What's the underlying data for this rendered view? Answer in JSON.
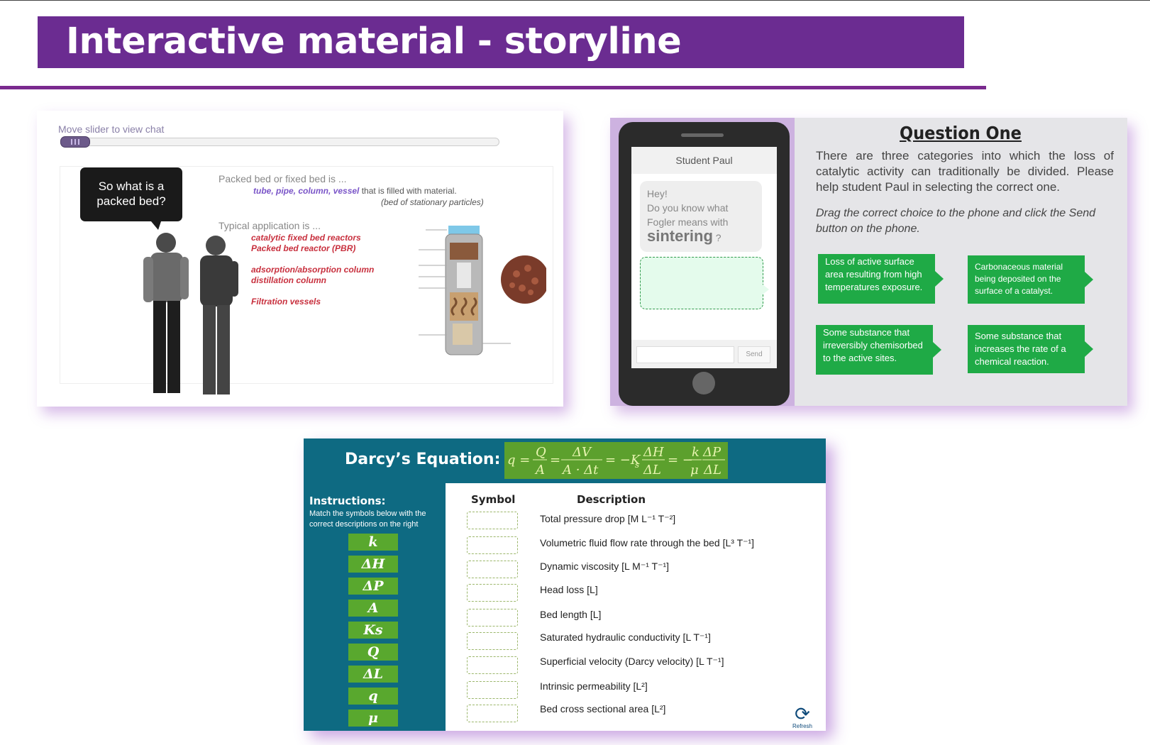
{
  "page": {
    "title": "Interactive material - storyline"
  },
  "panel1": {
    "slider_label": "Move slider to view chat",
    "speech_bubble": "So what is a packed bed?",
    "heading1": "Packed bed or fixed bed is ...",
    "line1_em": "tube, pipe, column, vessel",
    "line1_rest": " that is filled with material.",
    "line2": "(bed of stationary particles)",
    "heading2": "Typical application is ...",
    "apps": [
      "catalytic fixed bed reactors",
      "Packed bed reactor (PBR)",
      "adsorption/absorption column",
      "distillation column",
      "Filtration vessels"
    ]
  },
  "panel2": {
    "phone_contact": "Student Paul",
    "message_lines": [
      "Hey!",
      "Do you know what",
      "Fogler means with"
    ],
    "message_keyword": "sintering",
    "message_suffix": "?",
    "send_label": "Send",
    "question_title": "Question One",
    "question_body": "There are three categories into which the loss of catalytic activity can traditionally be divided. Please help student Paul in selecting the correct one.",
    "question_instruction": "Drag the correct choice to the phone and click the Send button on the phone.",
    "choices": [
      "Loss of active surface area resulting from high temperatures exposure.",
      "Carbonaceous material being deposited on the surface  of a catalyst.",
      "Some substance that irreversibly chemisorbed to the active sites.",
      "Some substance that increases the rate of a chemical reaction."
    ]
  },
  "panel3": {
    "title": "Darcy’s Equation:",
    "equation": "q = Q/A = ΔV/(A·Δt) = −Ks ΔH/ΔL = −(k/μ) ΔP/ΔL",
    "instructions_heading": "Instructions:",
    "instructions_text": "Match the symbols below with the correct descriptions on the right",
    "symbols": [
      "k",
      "ΔH",
      "ΔP",
      "A",
      "Ks",
      "Q",
      "ΔL",
      "q",
      "μ"
    ],
    "col_symbol": "Symbol",
    "col_description": "Description",
    "descriptions": [
      "Total pressure drop [M L⁻¹ T⁻²]",
      "Volumetric fluid flow rate through the bed [L³ T⁻¹]",
      "Dynamic viscosity [L M⁻¹ T⁻¹]",
      "Head loss [L]",
      "Bed length [L]",
      "Saturated hydraulic conductivity [L T⁻¹]",
      "Superficial velocity (Darcy velocity) [L T⁻¹]",
      "Intrinsic permeability [L²]",
      "Bed cross sectional area [L²]"
    ],
    "refresh_label": "Refresh"
  }
}
